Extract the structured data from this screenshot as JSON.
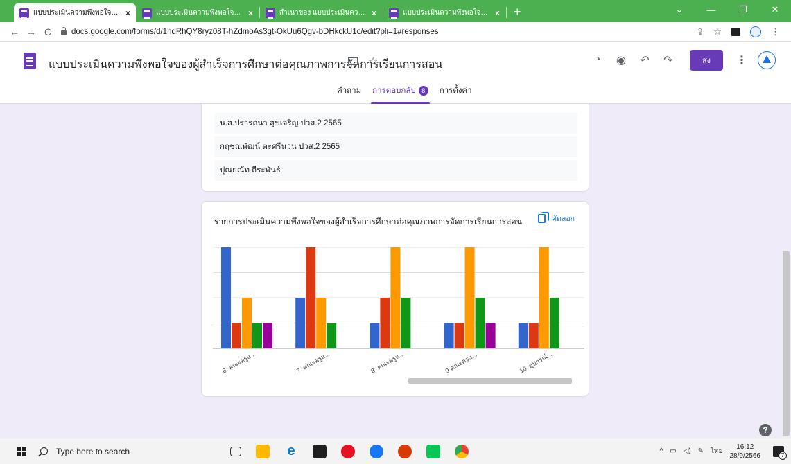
{
  "browser": {
    "tabs": [
      {
        "title": "แบบประเมินความพึงพอใจของผู้สำเร็จก",
        "active": true
      },
      {
        "title": "แบบประเมินความพึงพอใจของสถานประ",
        "active": false
      },
      {
        "title": "สำเนาของ แบบประเมินความพึงพอใจข",
        "active": false
      },
      {
        "title": "แบบประเมินความพึงพอใจของผู้ปกครอ",
        "active": false
      }
    ],
    "tab_close": "×",
    "new_tab": "+",
    "url": "docs.google.com/forms/d/1hdRhQY8ryz08T-hZdmoAs3gt-OkUu6Qgv-bDHkckU1c/edit?pli=1#responses",
    "nav": {
      "back": "←",
      "forward": "→",
      "reload": "C"
    },
    "window_controls": {
      "chevron": "⌄",
      "minimize": "—",
      "maximize": "❐",
      "close": "✕"
    },
    "addr_icons": {
      "share": "⇪",
      "bookmark": "☆",
      "menu": "⋮"
    }
  },
  "form": {
    "title": "แบบประเมินความพึงพอใจของผู้สำเร็จการศึกษาต่อคุณภาพการจัดการเรียนการสอน",
    "star": "☆",
    "send_label": "ส่ง",
    "header_icons": {
      "palette": "◔",
      "preview": "◉",
      "undo": "↶",
      "redo": "↷",
      "more": "⋮"
    },
    "tabs": [
      {
        "label": "คำถาม",
        "active": false
      },
      {
        "label": "การตอบกลับ",
        "active": true,
        "badge": "8"
      },
      {
        "label": "การตั้งค่า",
        "active": false
      }
    ]
  },
  "responses": {
    "names": [
      "น.ส.ปรารถนา สุขเจริญ ปวส.2 2565",
      "กฤชณพัฒน์ ตะศรีนวน ปวส.2 2565",
      "ปุณยณัท ถีระพันธ์"
    ]
  },
  "chart_card": {
    "copy_label": "คัดลอก",
    "help": "?"
  },
  "chart_data": {
    "type": "bar",
    "title": "รายการประเมินความพึงพอใจของผู้สำเร็จการศึกษาต่อคุณภาพการจัดการเรียนการสอน",
    "categories": [
      "6. คณะครูแ...",
      "7. คณะครูแ...",
      "8. คณะครูแ...",
      "9.คณะครูแ...",
      "10. อุปกรณ์..."
    ],
    "series": [
      {
        "color": "#3366cc",
        "values": [
          4,
          2,
          1,
          1,
          1
        ]
      },
      {
        "color": "#dc3912",
        "values": [
          1,
          4,
          2,
          1,
          1
        ]
      },
      {
        "color": "#ff9900",
        "values": [
          2,
          2,
          4,
          4,
          4
        ]
      },
      {
        "color": "#109618",
        "values": [
          1,
          1,
          2,
          2,
          2
        ]
      },
      {
        "color": "#990099",
        "values": [
          1,
          0,
          0,
          1,
          0
        ]
      }
    ],
    "ylim": [
      0,
      4
    ],
    "grid": true
  },
  "taskbar": {
    "search_placeholder": "Type here to search",
    "lang": "ไทย",
    "time": "16:12",
    "date": "28/9/2566",
    "notifications": "7"
  }
}
